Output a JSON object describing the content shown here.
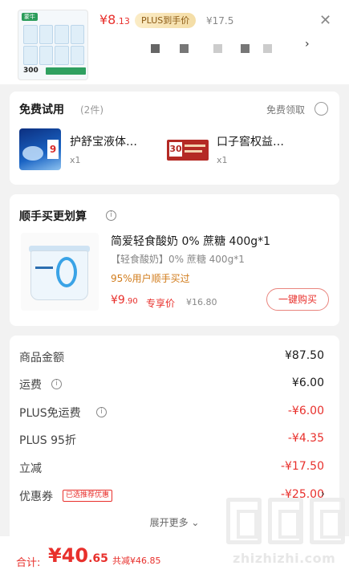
{
  "product": {
    "brand_badge": "蒙牛",
    "image_count": "300",
    "price_main": "¥8",
    "price_cents": ".13",
    "plus_label": "PLUS到手价",
    "original_price": "¥17.5"
  },
  "icons": {
    "close": "close-icon",
    "chevron": "chevron-right-icon",
    "info": "info-icon"
  },
  "free_trial": {
    "title": "免费试用",
    "count": "(2件)",
    "claim_label": "免费领取",
    "items": [
      {
        "name": "护舒宝液体…",
        "qty": "x1",
        "badge": "9"
      },
      {
        "name": "口子窖权益…",
        "qty": "x1",
        "badge": "30"
      }
    ]
  },
  "addon": {
    "title": "顺手买更划算",
    "product_name": "简爱轻食酸奶 0% 蔗糖 400g*1",
    "subtitle": "【轻食酸奶】0% 蔗糖 400g*1",
    "bought_note": "95%用户顺手买过",
    "price_main": "¥9",
    "price_cents": ".90",
    "price_tag": "专享价",
    "original_price": "¥16.80",
    "buy_button": "一键购买"
  },
  "summary": {
    "rows": [
      {
        "label": "商品金额",
        "value": "¥87.50"
      },
      {
        "label": "运费",
        "value": "¥6.00"
      },
      {
        "label": "PLUS免运费",
        "value": "-¥6.00"
      },
      {
        "label": "PLUS 95折",
        "value": "-¥4.35"
      },
      {
        "label": "立减",
        "value": "-¥17.50"
      },
      {
        "label": "优惠券",
        "value": "-¥25.00",
        "tag": "已选推荐优惠"
      }
    ],
    "expand_label": "展开更多 ⌄"
  },
  "footer": {
    "total_label": "合计:",
    "total_main": "¥40",
    "total_cents": ".65",
    "saved": "共减¥46.85"
  },
  "watermark": {
    "site": "zhizhizhi.com"
  },
  "colors": {
    "accent": "#e8302c",
    "plus_gold": "#8c5a14",
    "bought_orange": "#d17b1a"
  }
}
